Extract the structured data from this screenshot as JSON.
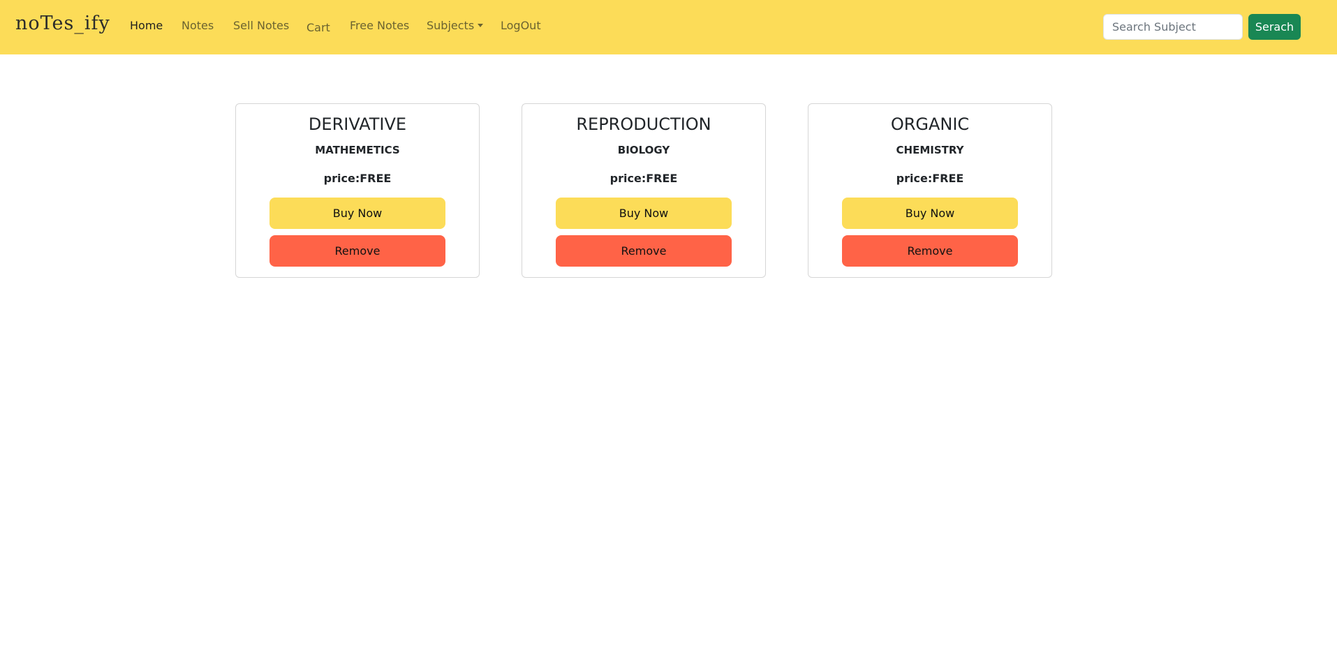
{
  "navbar": {
    "brand": "noTes_ify",
    "links": [
      "Home",
      "Notes",
      "Sell Notes",
      "Cart",
      "Free Notes",
      "Subjects",
      "LogOut"
    ],
    "search": {
      "placeholder": "Search Subject",
      "button_label": "Serach"
    }
  },
  "cards": [
    {
      "title": "DERIVATIVE",
      "subject": "MATHEMETICS",
      "price": "price:FREE",
      "buy_label": "Buy Now",
      "remove_label": "Remove"
    },
    {
      "title": "REPRODUCTION",
      "subject": "BIOLOGY",
      "price": "price:FREE",
      "buy_label": "Buy Now",
      "remove_label": "Remove"
    },
    {
      "title": "ORGANIC",
      "subject": "CHEMISTRY",
      "price": "price:FREE",
      "buy_label": "Buy Now",
      "remove_label": "Remove"
    }
  ],
  "colors": {
    "navbar_bg": "#fcdc58",
    "search_button": "#198754",
    "buy_button": "#fcdc58",
    "remove_button": "#ff6347"
  }
}
